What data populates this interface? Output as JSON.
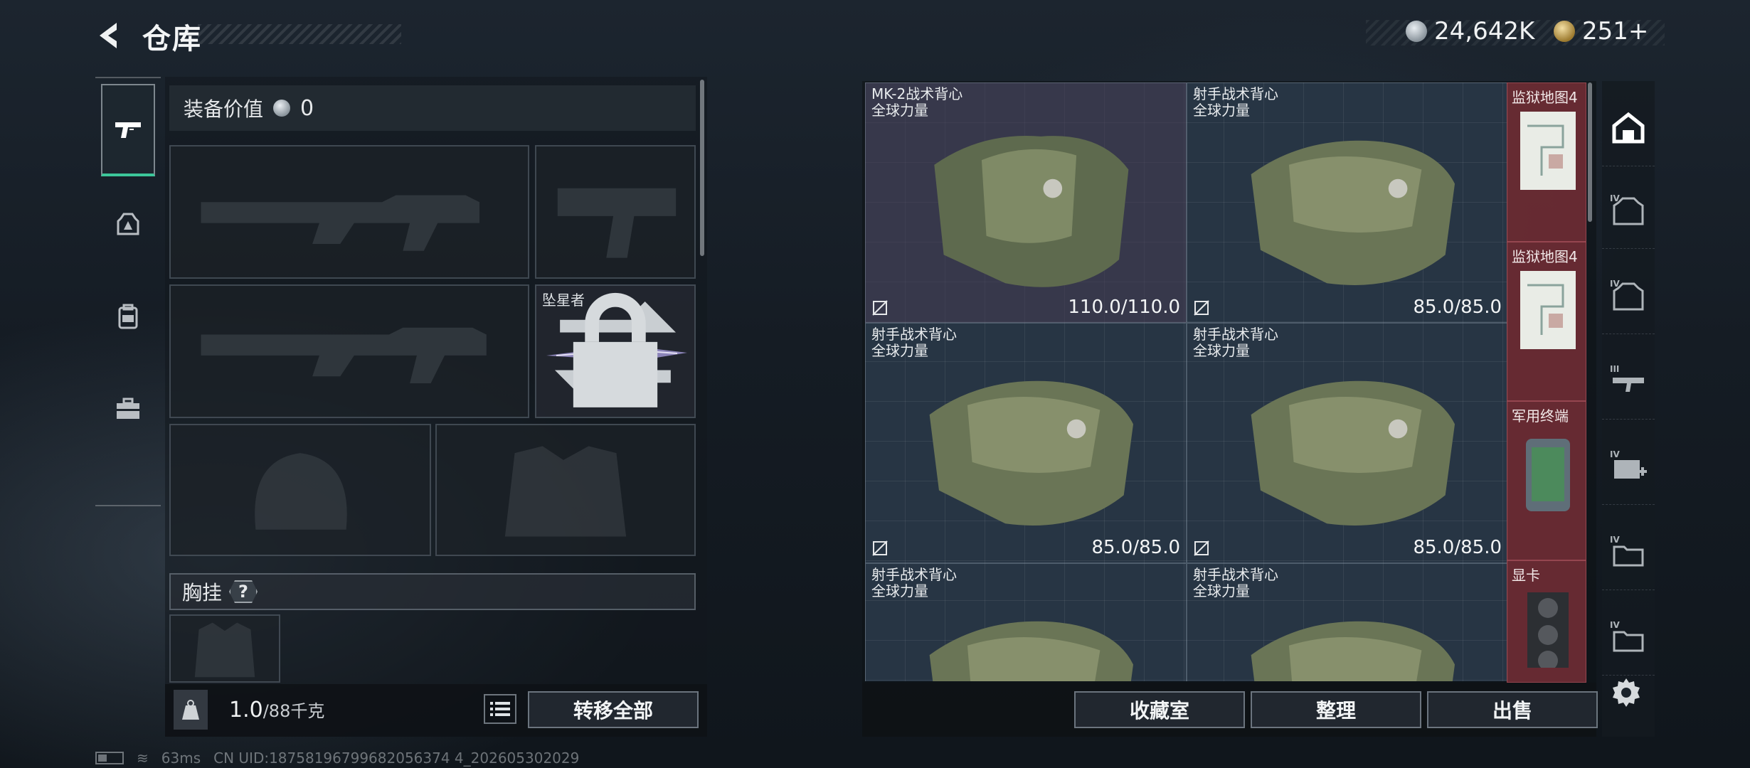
{
  "header": {
    "title": "仓库",
    "currency_silver": "24,642K",
    "currency_gold": "251+"
  },
  "left_nav": {
    "items": [
      {
        "name": "weapons",
        "icon": "pistol-icon",
        "active": true
      },
      {
        "name": "armor",
        "icon": "helmet-armor-icon",
        "active": false
      },
      {
        "name": "backpack",
        "icon": "backpack-icon",
        "active": false
      },
      {
        "name": "kit",
        "icon": "toolbox-icon",
        "active": false
      }
    ]
  },
  "loadout": {
    "value_label": "装备价值",
    "value": "0",
    "melee_name": "坠星者",
    "chest_label": "胸挂",
    "chest_help": "?",
    "weight_current": "1.0",
    "weight_max": "/88千克",
    "transfer_all_label": "转移全部"
  },
  "inventory": {
    "cells": [
      {
        "name_line1": "MK-2战术背心",
        "name_line2": "全球力量",
        "durability": "110.0/110.0",
        "selected": true
      },
      {
        "name_line1": "射手战术背心",
        "name_line2": "全球力量",
        "durability": "85.0/85.0",
        "selected": false
      },
      {
        "name_line1": "射手战术背心",
        "name_line2": "全球力量",
        "durability": "85.0/85.0",
        "selected": false
      },
      {
        "name_line1": "射手战术背心",
        "name_line2": "全球力量",
        "durability": "85.0/85.0",
        "selected": false
      },
      {
        "name_line1": "射手战术背心",
        "name_line2": "全球力量",
        "durability": "",
        "selected": false
      },
      {
        "name_line1": "射手战术背心",
        "name_line2": "全球力量",
        "durability": "",
        "selected": false
      }
    ],
    "side_items": [
      {
        "name": "监狱地图4"
      },
      {
        "name": "监狱地图4"
      },
      {
        "name": "军用终端"
      },
      {
        "name": "显卡"
      }
    ],
    "buttons": {
      "collection": "收藏室",
      "sort": "整理",
      "sell": "出售"
    }
  },
  "right_strip": {
    "categories": [
      {
        "icon": "home-storage-icon",
        "tier": ""
      },
      {
        "icon": "armor-tier-icon",
        "tier": "IV"
      },
      {
        "icon": "armor-tier-icon",
        "tier": "IV"
      },
      {
        "icon": "rifle-tier-icon",
        "tier": "III"
      },
      {
        "icon": "medkit-tier-icon",
        "tier": "IV"
      },
      {
        "icon": "folder-tier-icon",
        "tier": "IV"
      },
      {
        "icon": "folder-tier-icon",
        "tier": "IV"
      }
    ]
  },
  "footer": {
    "ping": "63ms",
    "uid": "CN UID:18758196799682056374 4_202605302029"
  },
  "colors": {
    "accent_green": "#3cc79a",
    "rare_red": "#6e2c34",
    "grid_blue": "#273544"
  }
}
